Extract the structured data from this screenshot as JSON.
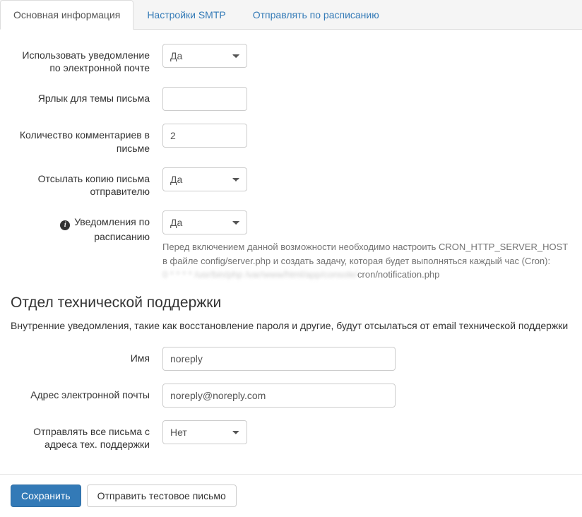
{
  "tabs": {
    "main": "Основная информация",
    "smtp": "Настройки SMTP",
    "schedule": "Отправлять по расписанию"
  },
  "form": {
    "use_email_notification": {
      "label": "Использовать уведомление по электронной почте",
      "value": "Да"
    },
    "subject_label": {
      "label": "Ярлык для темы письма",
      "value": ""
    },
    "comments_count": {
      "label": "Количество комментариев в письме",
      "value": "2"
    },
    "send_copy": {
      "label": "Отсылать копию письма отправителю",
      "value": "Да"
    },
    "scheduled_notifications": {
      "label": "Уведомления по расписанию",
      "value": "Да",
      "help_line1": "Перед включением данной возможности необходимо настроить CRON_HTTP_SERVER_HOST в файле config/server.php и создать задачу, которая будет выполняться каждый час (Cron):",
      "help_blurred": "0 * * * * /usr/bin/php /var/www/html/app/console/",
      "help_line2_suffix": "cron/notification.php"
    }
  },
  "support_section": {
    "heading": "Отдел технической поддержки",
    "description": "Внутренние уведомления, такие как восстановление пароля и другие, будут отсылаться от email технической поддержки",
    "name": {
      "label": "Имя",
      "value": "noreply"
    },
    "email": {
      "label": "Адрес электронной почты",
      "value": "noreply@noreply.com"
    },
    "send_all_from_support": {
      "label": "Отправлять все письма с адреса тех. поддержки",
      "value": "Нет"
    }
  },
  "footer": {
    "save": "Сохранить",
    "send_test": "Отправить тестовое письмо"
  }
}
